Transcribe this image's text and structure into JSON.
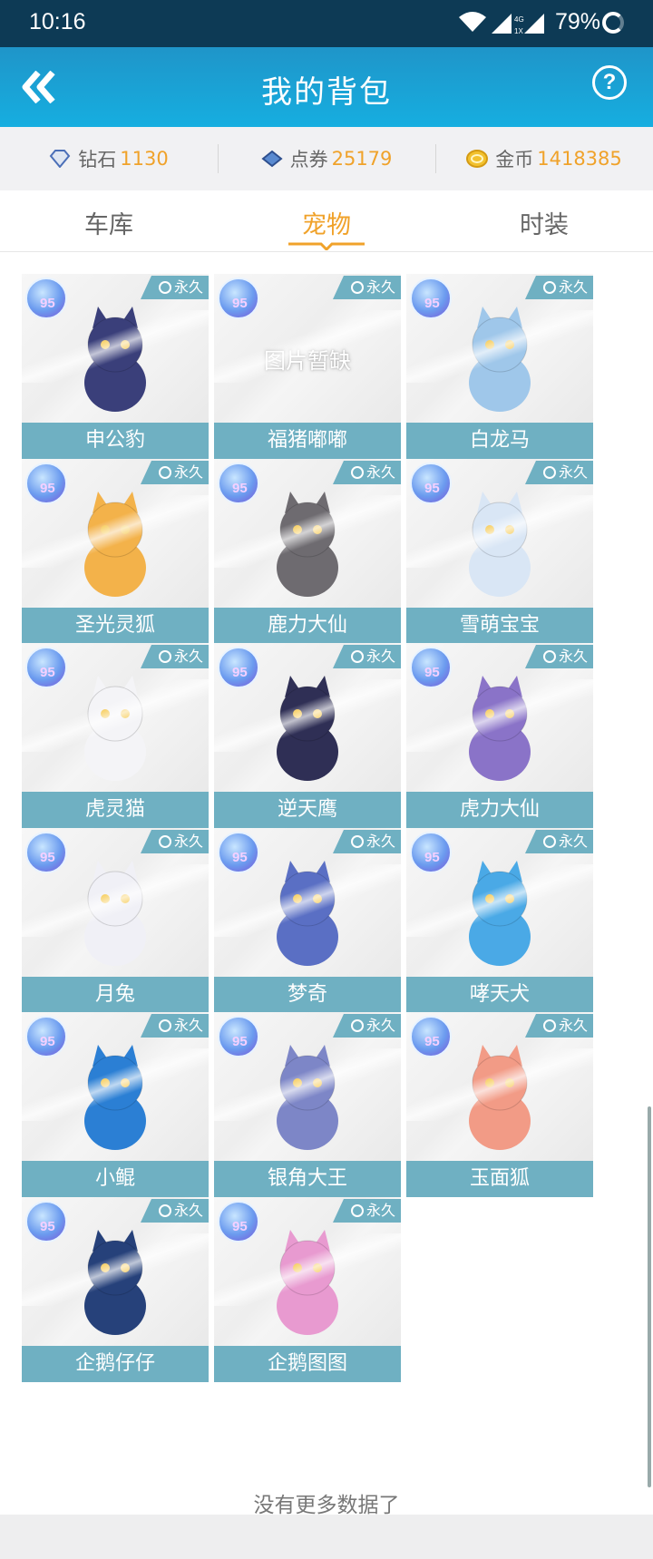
{
  "status_bar": {
    "time": "10:16",
    "battery": "79%",
    "network": "4G",
    "sim_slot": "1X"
  },
  "header": {
    "title": "我的背包",
    "back_icon": "double-chevron-left-icon",
    "help_icon": "question-circle-icon",
    "help_glyph": "?"
  },
  "currency": [
    {
      "label": "钻石",
      "value": "1130",
      "icon": "diamond-icon"
    },
    {
      "label": "点券",
      "value": "25179",
      "icon": "coupon-icon"
    },
    {
      "label": "金币",
      "value": "1418385",
      "icon": "gold-coin-icon"
    }
  ],
  "tabs": [
    {
      "label": "车库",
      "active": false
    },
    {
      "label": "宠物",
      "active": true
    },
    {
      "label": "时装",
      "active": false
    }
  ],
  "badge_level": "95",
  "permanent_label": "永久",
  "missing_image_label": "图片暂缺",
  "pets": [
    {
      "name": "申公豹",
      "color": "#3a3f7a"
    },
    {
      "name": "福猪嘟嘟",
      "color": "",
      "missing": true
    },
    {
      "name": "白龙马",
      "color": "#9fc7ea"
    },
    {
      "name": "圣光灵狐",
      "color": "#f3b24a"
    },
    {
      "name": "鹿力大仙",
      "color": "#6e6b70"
    },
    {
      "name": "雪萌宝宝",
      "color": "#d9e6f5"
    },
    {
      "name": "虎灵猫",
      "color": "#f4f4f7"
    },
    {
      "name": "逆天鹰",
      "color": "#2f2f55"
    },
    {
      "name": "虎力大仙",
      "color": "#8a73c8"
    },
    {
      "name": "月兔",
      "color": "#f0f0f6"
    },
    {
      "name": "梦奇",
      "color": "#5a6fc4"
    },
    {
      "name": "哮天犬",
      "color": "#4aa9e6"
    },
    {
      "name": "小鲲",
      "color": "#2b7fd4"
    },
    {
      "name": "银角大王",
      "color": "#7d86c7"
    },
    {
      "name": "玉面狐",
      "color": "#f29b86"
    },
    {
      "name": "企鹅仔仔",
      "color": "#26417a"
    },
    {
      "name": "企鹅图图",
      "color": "#e89ad0"
    }
  ],
  "footer": {
    "no_more": "没有更多数据了"
  }
}
